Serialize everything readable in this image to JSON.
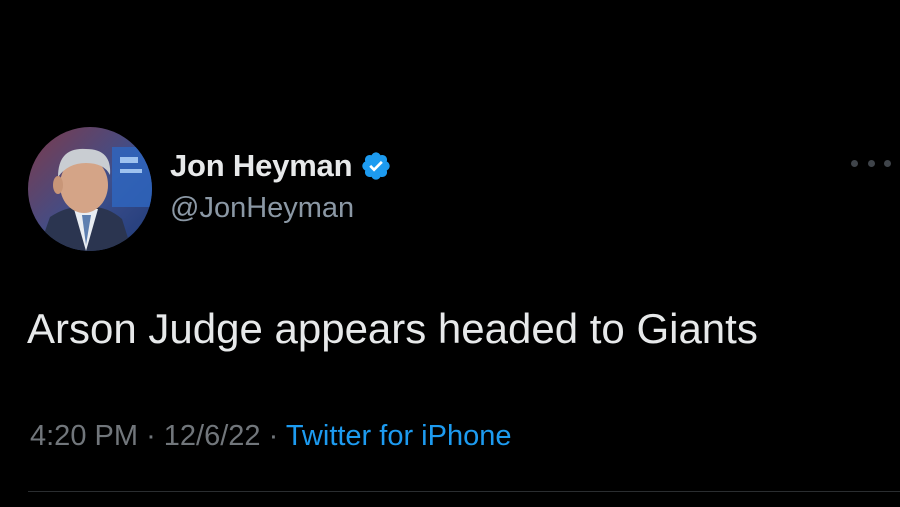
{
  "tweet": {
    "display_name": "Jon Heyman",
    "handle": "@JonHeyman",
    "text": "Arson Judge appears headed to Giants",
    "time": "4:20 PM",
    "separator": "·",
    "date": "12/6/22",
    "source": "Twitter for iPhone",
    "verified": true
  },
  "icons": {
    "verified": "verified-badge-icon",
    "more": "more-options-icon"
  },
  "colors": {
    "background": "#000000",
    "text": "#e7e9ea",
    "secondary": "#71767b",
    "accent": "#1d9bf0"
  }
}
